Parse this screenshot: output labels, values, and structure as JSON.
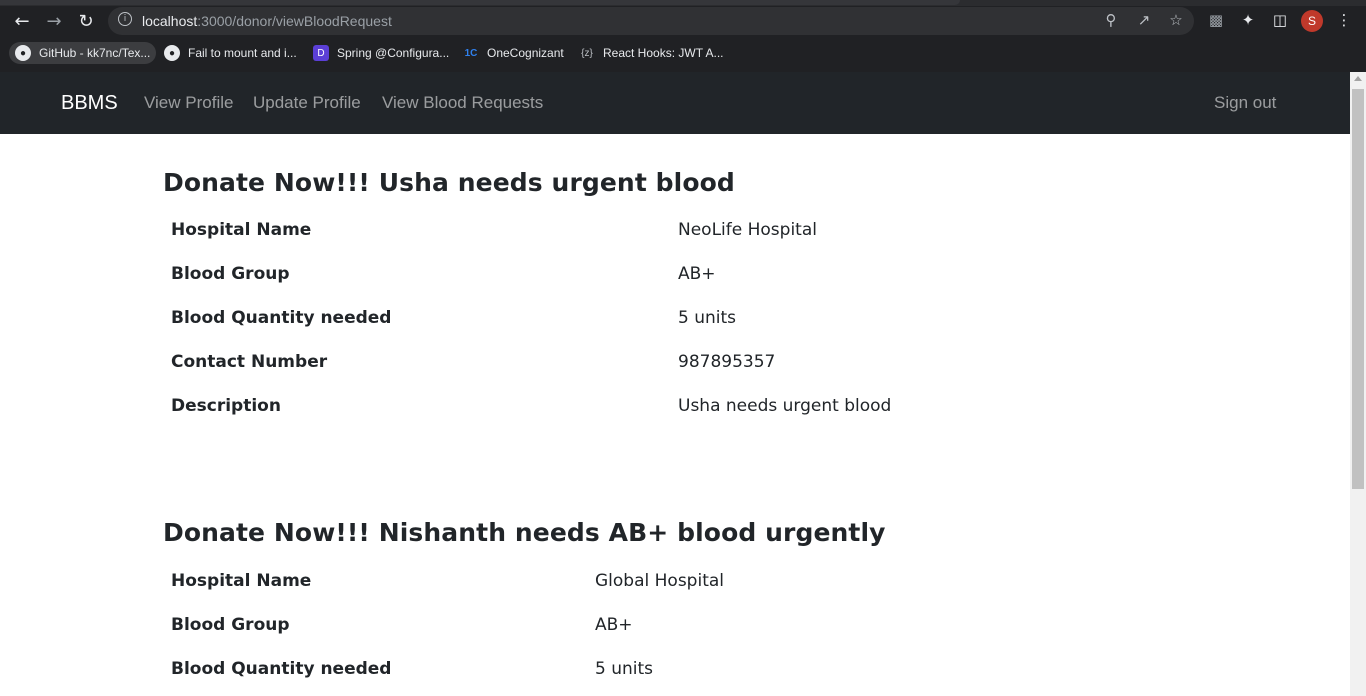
{
  "browser": {
    "url_host": "localhost",
    "url_rest": ":3000/donor/viewBloodRequest",
    "profile_initial": "S",
    "bookmarks": [
      {
        "label": "GitHub - kk7nc/Tex..."
      },
      {
        "label": "Fail to mount and i..."
      },
      {
        "label": "Spring @Configura..."
      },
      {
        "label": "OneCognizant"
      },
      {
        "label": "React Hooks: JWT A..."
      }
    ]
  },
  "navbar": {
    "brand": "BBMS",
    "links": [
      "View Profile",
      "Update Profile",
      "View Blood Requests"
    ],
    "signout": "Sign out"
  },
  "requests": [
    {
      "title": "Donate Now!!! Usha needs urgent blood",
      "rows": [
        {
          "key": "Hospital Name",
          "value": "NeoLife Hospital"
        },
        {
          "key": "Blood Group",
          "value": "AB+"
        },
        {
          "key": "Blood Quantity needed",
          "value": "5 units"
        },
        {
          "key": "Contact Number",
          "value": "987895357"
        },
        {
          "key": "Description",
          "value": "Usha needs urgent blood"
        }
      ]
    },
    {
      "title": "Donate Now!!! Nishanth needs AB+ blood urgently",
      "rows": [
        {
          "key": "Hospital Name",
          "value": "Global Hospital"
        },
        {
          "key": "Blood Group",
          "value": "AB+"
        },
        {
          "key": "Blood Quantity needed",
          "value": "5 units"
        }
      ]
    }
  ]
}
